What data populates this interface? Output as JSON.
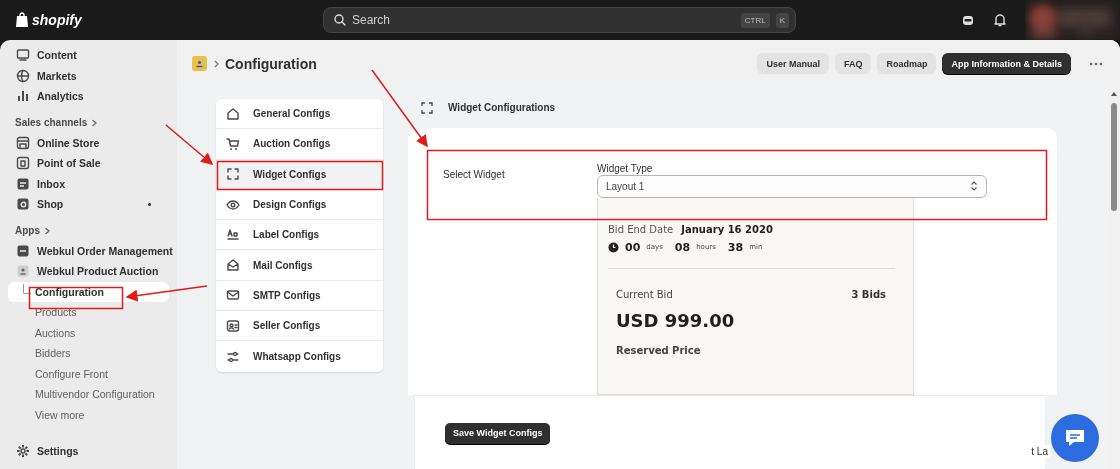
{
  "top_bar": {
    "logo": "shopify",
    "search": {
      "placeholder": "Search"
    },
    "shortcut_keys": [
      "CTRL",
      "K"
    ]
  },
  "sidebar": {
    "items": [
      {
        "kind": "item",
        "label": "Content",
        "selected": false
      },
      {
        "kind": "item",
        "label": "Markets",
        "selected": false
      },
      {
        "kind": "item",
        "label": "Analytics",
        "selected": false
      },
      {
        "kind": "section",
        "label": "Sales channels"
      },
      {
        "kind": "item",
        "label": "Online Store",
        "selected": false
      },
      {
        "kind": "item",
        "label": "Point of Sale",
        "selected": false
      },
      {
        "kind": "item",
        "label": "Inbox",
        "selected": false
      },
      {
        "kind": "item",
        "label": "Shop",
        "selected": false,
        "dot": true
      },
      {
        "kind": "section",
        "label": "Apps"
      },
      {
        "kind": "item",
        "label": "Webkul Order Management",
        "selected": false
      },
      {
        "kind": "item",
        "label": "Webkul Product Auction",
        "selected": false
      },
      {
        "kind": "subitem",
        "label": "Configuration",
        "selected": true
      },
      {
        "kind": "subitem",
        "label": "Products",
        "selected": false
      },
      {
        "kind": "subitem",
        "label": "Auctions",
        "selected": false
      },
      {
        "kind": "subitem",
        "label": "Bidders",
        "selected": false
      },
      {
        "kind": "subitem",
        "label": "Configure Front",
        "selected": false
      },
      {
        "kind": "subitem",
        "label": "Multivendor Configuration",
        "selected": false
      },
      {
        "kind": "subitem",
        "label": "View more",
        "selected": false
      },
      {
        "kind": "footer",
        "label": "Settings",
        "selected": false
      }
    ]
  },
  "page_header": {
    "title": "Configuration",
    "buttons": [
      {
        "label": "User Manual",
        "kind": "secondary"
      },
      {
        "label": "FAQ",
        "kind": "secondary"
      },
      {
        "label": "Roadmap",
        "kind": "secondary"
      },
      {
        "label": "App Information & Details",
        "kind": "primary"
      }
    ]
  },
  "config_menu": {
    "items": [
      {
        "label": "General Configs",
        "selected": false
      },
      {
        "label": "Auction Configs",
        "selected": false
      },
      {
        "label": "Widget Configs",
        "selected": true
      },
      {
        "label": "Design Configs",
        "selected": false
      },
      {
        "label": "Label Configs",
        "selected": false
      },
      {
        "label": "Mail Configs",
        "selected": false
      },
      {
        "label": "SMTP Configs",
        "selected": false
      },
      {
        "label": "Seller Configs",
        "selected": false
      },
      {
        "label": "Whatsapp Configs",
        "selected": false
      }
    ]
  },
  "widget_panel": {
    "heading": "Widget Configurations",
    "section_label": "Select Widget",
    "select": {
      "label": "Widget Type",
      "value": "Layout 1"
    },
    "preview": {
      "end_date_label": "Bid End Date",
      "end_date": "January 16 2020",
      "countdown": [
        {
          "value": "00",
          "unit": "days"
        },
        {
          "value": "08",
          "unit": "hours"
        },
        {
          "value": "38",
          "unit": "min"
        }
      ],
      "current_bid_label": "Current Bid",
      "bid_count": "3 Bids",
      "current_bid": "USD 999.00",
      "reserved_label": "Reserved Price"
    },
    "save_button": "Save Widget Configs"
  },
  "language_selector": "t La"
}
